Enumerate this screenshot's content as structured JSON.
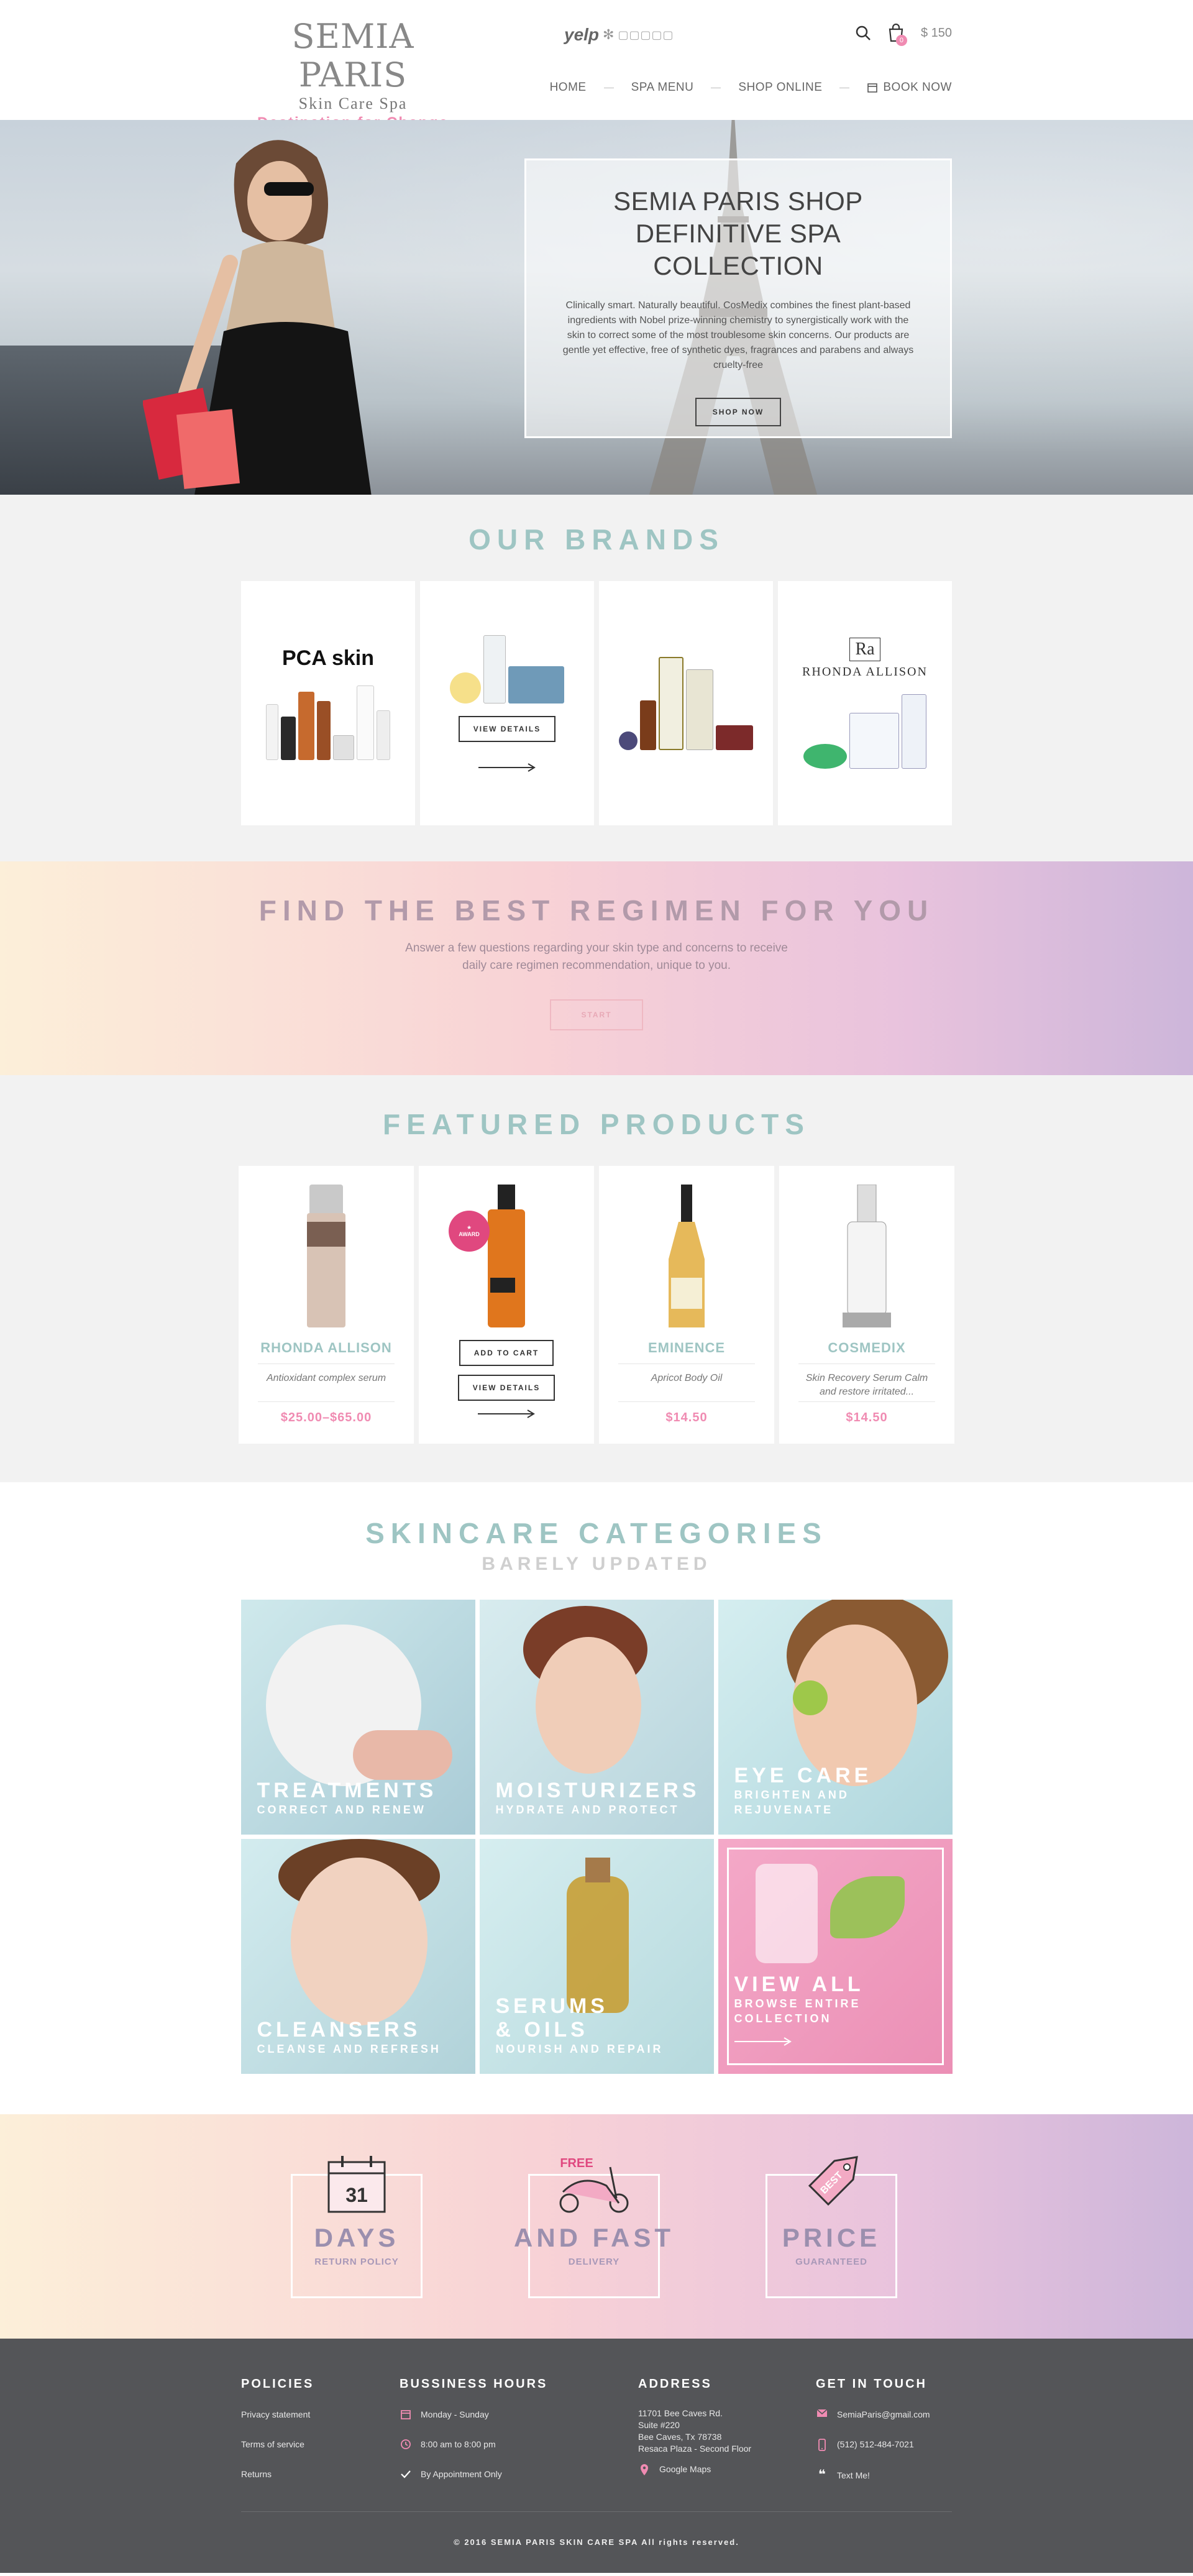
{
  "header": {
    "logo_title": "SEMIA PARIS",
    "logo_subtitle": "Skin Care Spa",
    "logo_tagline": "Destination for Change",
    "yelp_label": "yelp",
    "cart_count": "0",
    "cart_total": "$ 150",
    "nav": [
      {
        "label": "HOME"
      },
      {
        "label": "SPA MENU"
      },
      {
        "label": "SHOP ONLINE"
      },
      {
        "label": "BOOK NOW"
      }
    ]
  },
  "hero": {
    "title": "SEMIA PARIS SHOP DEFINITIVE SPA COLLECTION",
    "text": "Clinically smart. Naturally beautiful. CosMedix combines the finest plant-based ingredients with Nobel prize-winning chemistry to synergistically work with the skin to correct some of the most troublesome skin concerns. Our products are gentle yet effective, free of synthetic dyes, fragrances and parabens and always cruelty-free",
    "button": "SHOP NOW"
  },
  "brands": {
    "title": "OUR BRANDS",
    "view_details": "VIEW DETAILS",
    "pca_logo": "PCA skin",
    "rhonda_logo": "RHONDA ALLISON"
  },
  "regimen": {
    "title": "FIND THE BEST REGIMEN FOR YOU",
    "text_line1": "Answer a few questions regarding your skin type and concerns to receive",
    "text_line2": "daily care regimen recommendation, unique to you.",
    "button": "START"
  },
  "featured": {
    "title": "FEATURED PRODUCTS",
    "add_to_cart": "ADD TO CART",
    "view_details": "VIEW DETAILS",
    "products": [
      {
        "brand": "RHONDA ALLISON",
        "desc": "Antioxidant complex serum",
        "price": "$25.00–$65.00"
      },
      {
        "brand": "",
        "desc": "",
        "price": ""
      },
      {
        "brand": "EMINENCE",
        "desc": "Apricot Body Oil",
        "price": "$14.50"
      },
      {
        "brand": "COSMEDIX",
        "desc": "Skin Recovery Serum Calm and restore irritated...",
        "price": "$14.50"
      }
    ]
  },
  "categories": {
    "title": "SKINCARE CATEGORIES",
    "subtitle": "BARELY UPDATED",
    "items": [
      {
        "title": "TREATMENTS",
        "subtitle": "CORRECT AND RENEW"
      },
      {
        "title": "MOISTURIZERS",
        "subtitle": "HYDRATE AND PROTECT"
      },
      {
        "title": "EYE CARE",
        "subtitle": "BRIGHTEN AND REJUVENATE"
      },
      {
        "title": "CLEANSERS",
        "subtitle": "CLEANSE AND REFRESH"
      },
      {
        "title": "SERUMS & OILS",
        "subtitle": "NOURISH AND REPAIR"
      },
      {
        "title": "VIEW ALL",
        "subtitle": "BROWSE ENTIRE COLLECTION"
      }
    ]
  },
  "features": [
    {
      "title": "DAYS",
      "subtitle": "RETURN POLICY",
      "icon_text": "31"
    },
    {
      "title": "AND FAST",
      "subtitle": "DELIVERY",
      "icon_text": "FREE"
    },
    {
      "title": "PRICE",
      "subtitle": "GUARANTEED",
      "icon_text": "BEST"
    }
  ],
  "footer": {
    "policies": {
      "title": "POLICIES",
      "items": [
        "Privacy statement",
        "Terms of service",
        "Returns"
      ]
    },
    "hours": {
      "title": "BUSSINESS HOURS",
      "items": [
        "Monday - Sunday",
        "8:00 am to 8:00 pm",
        "By Appointment Only"
      ]
    },
    "address": {
      "title": "ADDRESS",
      "lines": [
        "11701 Bee Caves Rd.",
        "Suite #220",
        "Bee Caves, Tx 78738",
        "Resaca Plaza - Second Floor"
      ],
      "maps": "Google Maps"
    },
    "contact": {
      "title": "GET IN TOUCH",
      "email": "SemiaParis@gmail.com",
      "phone": "(512) 512-484-7021",
      "text": "Text Me!"
    },
    "copyright": "© 2016 SEMIA PARIS SKIN CARE SPA All rights reserved."
  },
  "colors": {
    "accent_pink": "#f08bb2",
    "accent_teal": "#9ec5c3",
    "footer_bg": "#545558"
  }
}
